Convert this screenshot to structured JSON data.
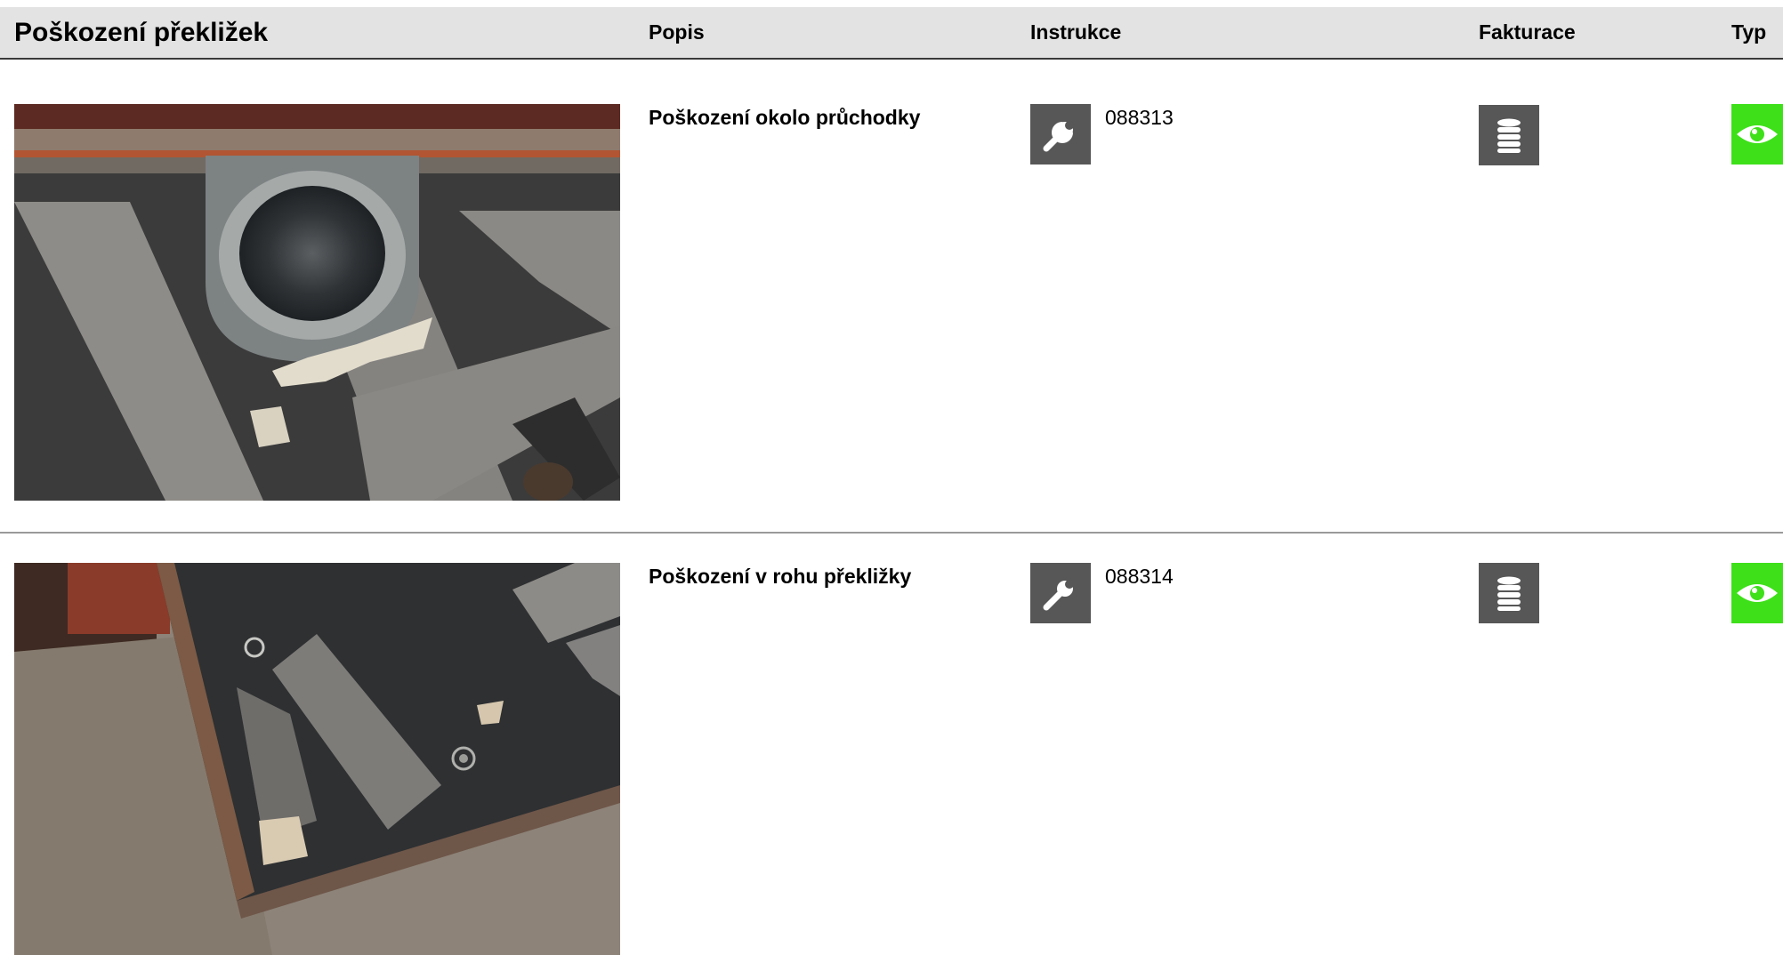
{
  "header": {
    "title": "Poškození překližek",
    "columns": {
      "popis": "Popis",
      "instrukce": "Instrukce",
      "fakturace": "Fakturace",
      "typ": "Typ"
    }
  },
  "rows": [
    {
      "description": "Poškození okolo průchodky",
      "instruction_code": "088313",
      "instruction_icon": "wrench-icon",
      "billing_icon": "coins-icon",
      "type_icon": "eye-icon"
    },
    {
      "description": "Poškození v rohu překližky",
      "instruction_code": "088314",
      "instruction_icon": "wrench-icon",
      "billing_icon": "coins-icon",
      "type_icon": "eye-icon"
    }
  ],
  "colors": {
    "header_bg": "#e3e3e3",
    "icon_button_bg": "#575757",
    "type_button_bg": "#3ee01a"
  }
}
